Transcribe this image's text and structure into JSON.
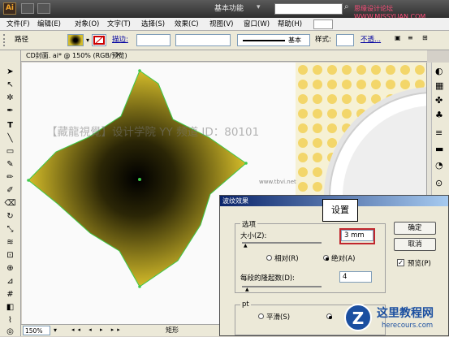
{
  "app": {
    "logo": "Ai",
    "workspace": "基本功能",
    "site_watermark": "思缘设计论坛 WWW.MISSYUAN.COM"
  },
  "menu": [
    "文件(F)",
    "编辑(E)",
    "对象(O)",
    "文字(T)",
    "选择(S)",
    "效果(C)",
    "视图(V)",
    "窗口(W)",
    "帮助(H)"
  ],
  "control_bar": {
    "selection_label": "路径",
    "stroke_label": "描边:",
    "brush_label": "基本",
    "style_label": "样式:",
    "opacity_label": "不透..."
  },
  "document": {
    "tab_title": "CD封面. ai* @ 150% (RGB/预览)",
    "overlay_text": "【藏龍視覺】设计学院  YY 频道 ID：80101",
    "overlay_url": "www.tbvi.net"
  },
  "status": {
    "zoom": "150%",
    "tool": "矩形"
  },
  "dialog": {
    "title": "波纹效果",
    "callout": "设置",
    "options_group": "选项",
    "size_label": "大小(Z):",
    "size_value": "3 mm",
    "relative_label": "相对(R)",
    "absolute_label": "绝对(A)",
    "ridges_label": "每段的隆起数(D):",
    "ridges_value": "4",
    "ok_button": "确定",
    "cancel_button": "取消",
    "preview_label": "预览(P)",
    "points_group": "pt",
    "smooth_label": "平滑(S)"
  },
  "brand_watermark": {
    "name": "这里教程网",
    "url": "herecours.com"
  },
  "colors": {
    "shape_outer": "#d4bc2a",
    "shape_inner": "#000000",
    "path_green": "#3ec94a",
    "highlight_red": "#c1272d",
    "title_blue": "#0a246a"
  }
}
